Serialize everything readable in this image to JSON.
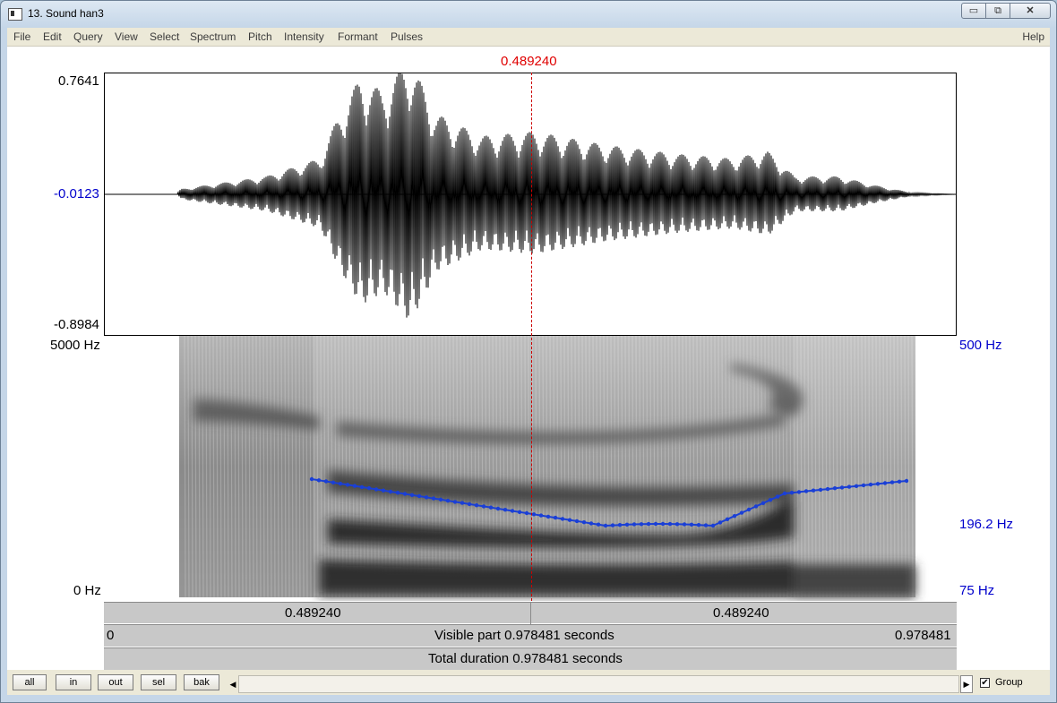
{
  "window": {
    "title": "13. Sound han3",
    "minimize": "▭",
    "maximize": "⧉",
    "close": "✕"
  },
  "menu": {
    "items": [
      "File",
      "Edit",
      "Query",
      "View",
      "Select",
      "Spectrum",
      "Pitch",
      "Intensity",
      "Formant",
      "Pulses"
    ],
    "help": "Help"
  },
  "cursor": {
    "time": "0.489240"
  },
  "waveform": {
    "max_label": "0.7641",
    "zero_label": "-0.0123",
    "min_label": "-0.8984"
  },
  "spectrogram": {
    "top_label": "5000 Hz",
    "bottom_label": "0 Hz"
  },
  "pitch": {
    "top_label": "500 Hz",
    "cursor_label": "196.2 Hz",
    "bottom_label": "75 Hz",
    "color": "#1a3fd6"
  },
  "bars": {
    "left_time": "0.489240",
    "right_time": "0.489240",
    "visible_start": "0",
    "visible_text": "Visible part 0.978481 seconds",
    "visible_end": "0.978481",
    "total_text": "Total duration 0.978481 seconds"
  },
  "toolbar": {
    "buttons": [
      "all",
      "in",
      "out",
      "sel",
      "bak"
    ],
    "scroll_left_icon": "◀",
    "scroll_right_icon": "▶",
    "group_checked": "✔",
    "group_label": "Group"
  }
}
